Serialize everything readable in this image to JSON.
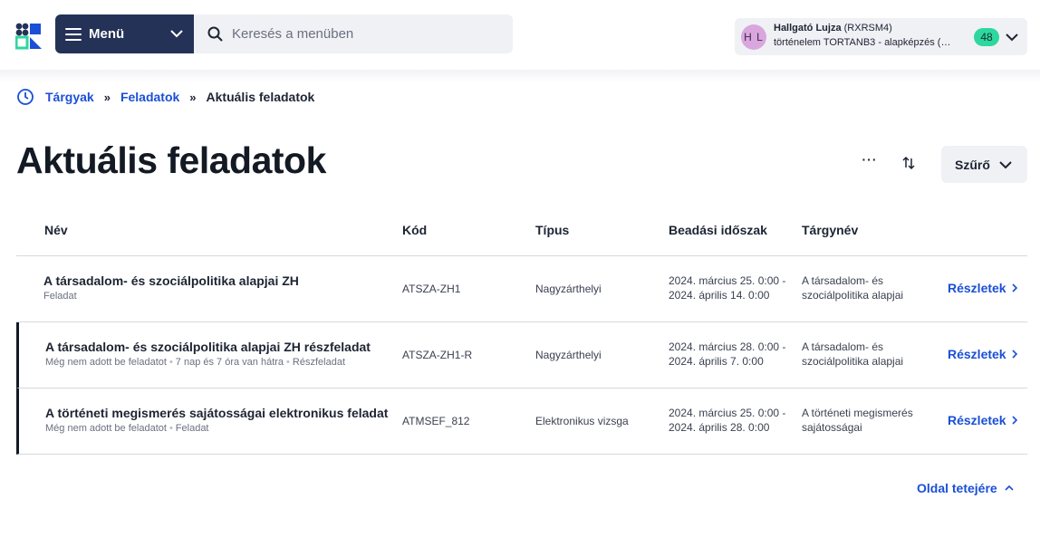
{
  "header": {
    "menu_label": "Menü",
    "search_placeholder": "Keresés a menüben",
    "user": {
      "initials": "H L",
      "name": "Hallgató Lujza",
      "code": "(RXRSM4)",
      "program": "történelem TORTANB3 - alapképzés (BA/...",
      "badge": "48"
    }
  },
  "breadcrumb": {
    "items": [
      "Tárgyak",
      "Feladatok"
    ],
    "separator": "»",
    "current": "Aktuális feladatok"
  },
  "page": {
    "title": "Aktuális feladatok",
    "more_label": "···",
    "filter_label": "Szűrő"
  },
  "table": {
    "columns": [
      "Név",
      "Kód",
      "Típus",
      "Beadási időszak",
      "Tárgynév"
    ],
    "details_label": "Részletek",
    "rows": [
      {
        "title": "A társadalom- és szociálpolitika alapjai ZH",
        "meta": [
          "Feladat"
        ],
        "code": "ATSZA-ZH1",
        "type": "Nagyzárthelyi",
        "period_line1": "2024. március 25. 0:00 -",
        "period_line2": "2024. április 14. 0:00",
        "subject_line1": "A társadalom- és",
        "subject_line2": "szociálpolitika alapjai"
      },
      {
        "title": "A társadalom- és szociálpolitika alapjai ZH részfeladat",
        "meta": [
          "Még nem adott be feladatot",
          "7 nap és 7 óra van hátra",
          "Részfeladat"
        ],
        "code": "ATSZA-ZH1-R",
        "type": "Nagyzárthelyi",
        "period_line1": "2024. március 28. 0:00 -",
        "period_line2": "2024. április 7. 0:00",
        "subject_line1": "A társadalom- és",
        "subject_line2": "szociálpolitika alapjai"
      },
      {
        "title": "A történeti megismerés sajátosságai elektronikus feladat",
        "meta": [
          "Még nem adott be feladatot",
          "Feladat"
        ],
        "code": "ATMSEF_812",
        "type": "Elektronikus vizsga",
        "period_line1": "2024. március 25. 0:00 -",
        "period_line2": "2024. április 28. 0:00",
        "subject_line1": "A történeti megismerés",
        "subject_line2": "sajátosságai"
      }
    ]
  },
  "footer": {
    "to_top_label": "Oldal tetejére"
  },
  "colors": {
    "navy": "#243257",
    "link": "#1a4fd6",
    "badge": "#2ed79e",
    "avatar": "#d9a7dd"
  }
}
